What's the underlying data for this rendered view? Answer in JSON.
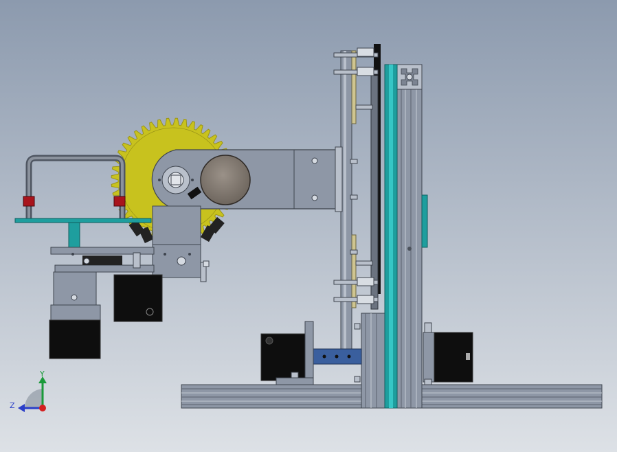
{
  "viewport": {
    "background_top": "#8c9aae",
    "background_bottom": "#dde1e6"
  },
  "triad": {
    "y_label": "Y",
    "z_label": "Z",
    "y_color": "#1a9a3a",
    "z_color": "#2a3ec8",
    "x_color": "#d42020"
  },
  "colors": {
    "gear": "#c8c21e",
    "gear_dark": "#9a9418",
    "metal": "#8e97a6",
    "metal_light": "#b9c0cb",
    "metal_dark": "#59606c",
    "teal": "#1e9e9e",
    "teal_light": "#36c6c6",
    "black": "#111111",
    "red": "#a8141c",
    "blue": "#3a5f9e",
    "tan": "#cfc590"
  }
}
